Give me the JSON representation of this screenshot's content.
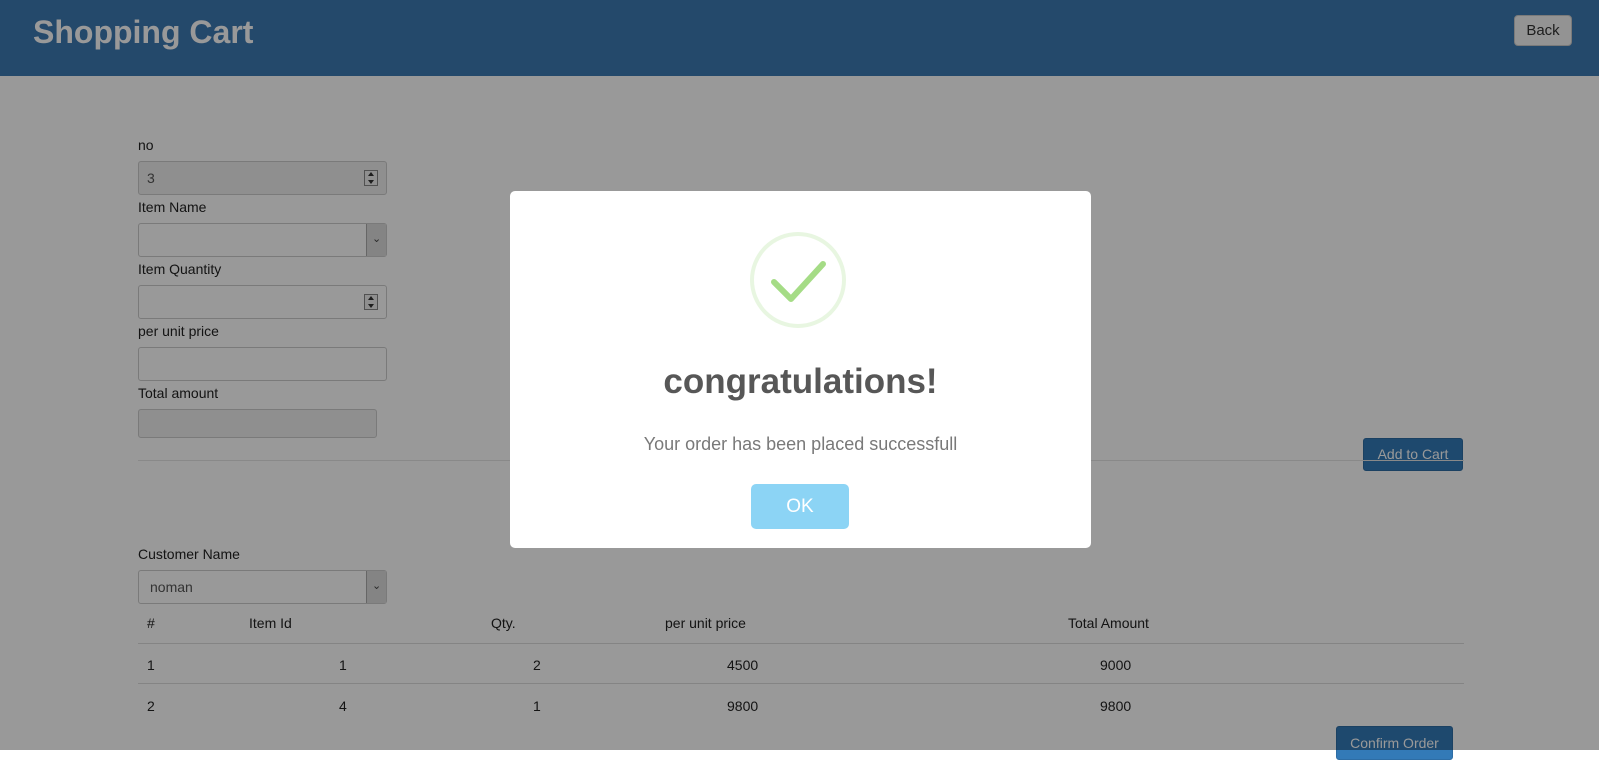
{
  "header": {
    "title": "Shopping Cart",
    "back_label": "Back"
  },
  "form": {
    "no_label": "no",
    "no_value": "3",
    "item_name_label": "Item Name",
    "item_name_value": "",
    "item_quantity_label": "Item Quantity",
    "item_quantity_value": "",
    "unit_price_label": "per unit price",
    "unit_price_value": "",
    "total_amount_label": "Total amount",
    "total_amount_value": "",
    "add_to_cart_label": "Add to Cart"
  },
  "customer": {
    "label": "Customer Name",
    "value": "noman"
  },
  "table": {
    "headers": [
      "#",
      "Item Id",
      "Qty.",
      "per unit price",
      "Total Amount"
    ],
    "rows": [
      [
        "1",
        "1",
        "2",
        "4500",
        "9000"
      ],
      [
        "2",
        "4",
        "1",
        "9800",
        "9800"
      ]
    ]
  },
  "confirm_label": "Confirm Order",
  "modal": {
    "icon": "checkmark-success-icon",
    "title": "congratulations!",
    "text": "Your order has been placed successfull",
    "ok_label": "OK"
  },
  "colors": {
    "navbar": "#3d7ab3",
    "primary": "#337ab7",
    "success": "#a5dc86",
    "ok_button": "#8cd4f5"
  }
}
